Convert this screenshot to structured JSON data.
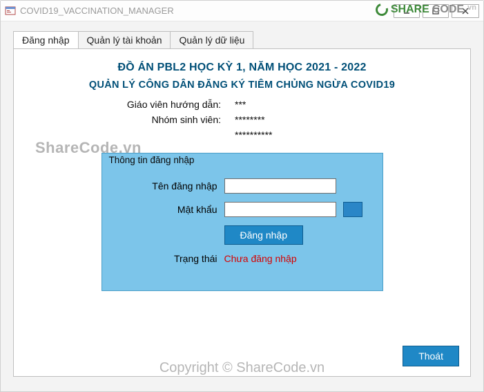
{
  "window": {
    "title": "COVID19_VACCINATION_MANAGER"
  },
  "sharecode_logo": {
    "share": "SHARE",
    "code": "CODE",
    "vn": ".vn"
  },
  "tabs": [
    {
      "label": "Đăng nhập"
    },
    {
      "label": "Quản lý tài khoản"
    },
    {
      "label": "Quản lý dữ liệu"
    }
  ],
  "headings": {
    "h1": "ĐỒ ÁN PBL2 HỌC KỲ 1, NĂM HỌC 2021 - 2022",
    "h2": "QUẢN LÝ CÔNG DÂN ĐĂNG KÝ TIÊM CHỦNG NGỪA COVID19"
  },
  "info": {
    "teacher_label": "Giáo viên hướng dẫn:",
    "teacher_value": "***",
    "students_label": "Nhóm sinh viên:",
    "students_value1": "********",
    "students_value2": "**********"
  },
  "login": {
    "group_title": "Thông tin đăng nhập",
    "username_label": "Tên đăng nhập",
    "username_value": "",
    "password_label": "Mật khẩu",
    "password_value": "",
    "login_button": "Đăng nhập",
    "status_label": "Trạng thái",
    "status_value": "Chưa đăng nhập"
  },
  "exit_button": "Thoát",
  "watermarks": {
    "wm1": "ShareCode.vn",
    "wm2": "Copyright © ShareCode.vn"
  }
}
